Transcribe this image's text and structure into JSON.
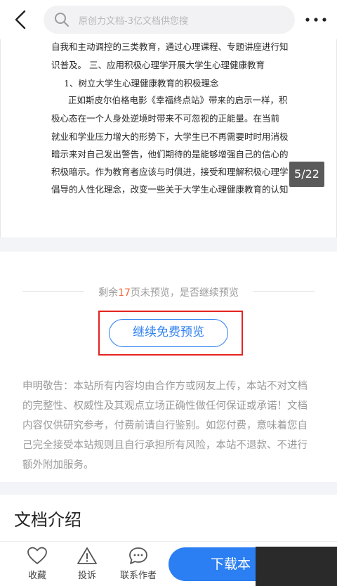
{
  "header": {
    "search_placeholder": "原创力文档-3亿文档供您搜"
  },
  "document": {
    "lines": [
      "自我和主动调控的三类教育，通过心理课程、专题讲座进行知",
      "识普及。    三、应用积极心理学开展大学生心理健康教育",
      "1、树立大学生心理健康教育的积极理念",
      "正如斯皮尔伯格电影《幸福终点站》带来的启示一样，积",
      "极心态在一个人身处逆境时带来不可忽视的正能量。在当前",
      "就业和学业压力增大的形势下，大学生已不再需要时时用消极",
      "暗示来对自己发出警告，他们期待的是能够增强自己的信心的",
      "积极暗示。作为教育者应该与时俱进，接受和理解积极心理学",
      "倡导的人性化理念，改变一些关于大学生心理健康教育的认知"
    ],
    "page_indicator": "5/22"
  },
  "preview": {
    "remain_prefix": "剩余",
    "remain_count": "17",
    "remain_suffix": "页未预览，是否继续预览",
    "continue_label": "继续免费预览",
    "notice": "申明敬告：本站所有内容均由合作方或网友上传，本站不对文档的完整性、权威性及其观点立场正确性做任何保证或承诺！文档内容仅供研究参考，付费前请自行鉴别。如您付费，意味着您自己完全接受本站规则且自行承担所有风险，本站不退款、不进行额外附加服务。"
  },
  "intro": {
    "title": "文档介绍"
  },
  "bottom": {
    "favorite": "收藏",
    "report": "投诉",
    "contact": "联系作者",
    "download": "下载本"
  },
  "colors": {
    "accent": "#2b7ff2",
    "highlight": "#f36a3a",
    "callout": "#e5231f"
  }
}
